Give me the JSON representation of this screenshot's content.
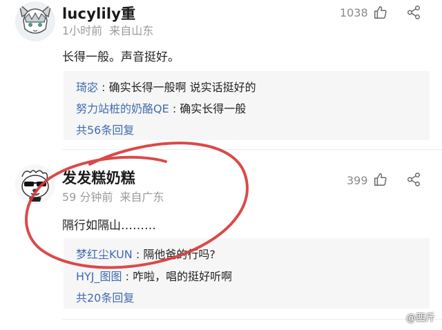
{
  "comments": [
    {
      "username": "lucylily重",
      "time": "1小时前",
      "location": "来自山东",
      "likes": "1038",
      "text": "长得一般。声音挺好。",
      "replies": [
        {
          "user": "琦宓",
          "text": "确实长得一般啊 说实话挺好的"
        },
        {
          "user": "努力站桩的奶酪QE",
          "text": "确实长得一般"
        }
      ],
      "more": "共56条回复"
    },
    {
      "username": "发发糕奶糕",
      "time": "59 分钟前",
      "location": "来自广东",
      "likes": "399",
      "text": "隔行如隔山………",
      "replies": [
        {
          "user": "梦红尘KUN",
          "text": "隔他爸的行吗?"
        },
        {
          "user": "HYJ_图图",
          "text": "咋啦，唱的挺好听啊"
        }
      ],
      "more": "共20条回复"
    }
  ],
  "reply_separator": ":",
  "watermark": "@西斤",
  "colors": {
    "link": "#3f6bb0",
    "annotation": "#d83a3a",
    "reply_bg": "#f6f6f6"
  },
  "icons": [
    "avatar-anime",
    "avatar-cool-dog",
    "thumbs-up-icon",
    "share-icon"
  ]
}
